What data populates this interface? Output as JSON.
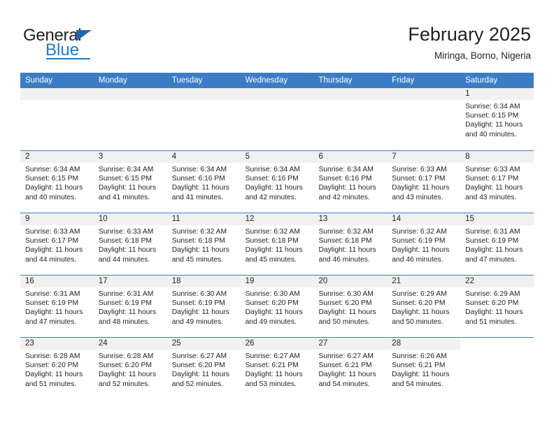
{
  "brand": {
    "name_part1": "General",
    "name_part2": "Blue",
    "triangle_color": "#1f68b0",
    "blue_color": "#1f7cc4"
  },
  "header": {
    "title": "February 2025",
    "subtitle": "Miringa, Borno, Nigeria",
    "header_bg": "#3b7dc4",
    "daynum_bg": "#f1f1f1"
  },
  "weekdays": [
    "Sunday",
    "Monday",
    "Tuesday",
    "Wednesday",
    "Thursday",
    "Friday",
    "Saturday"
  ],
  "labels": {
    "sunrise_prefix": "Sunrise:",
    "sunset_prefix": "Sunset:",
    "daylight_prefix": "Daylight:"
  },
  "weeks": [
    [
      {
        "empty": true
      },
      {
        "empty": true
      },
      {
        "empty": true
      },
      {
        "empty": true
      },
      {
        "empty": true
      },
      {
        "empty": true
      },
      {
        "day": "1",
        "sunrise": "Sunrise: 6:34 AM",
        "sunset": "Sunset: 6:15 PM",
        "daylight_line1": "Daylight: 11 hours",
        "daylight_line2": "and 40 minutes."
      }
    ],
    [
      {
        "day": "2",
        "sunrise": "Sunrise: 6:34 AM",
        "sunset": "Sunset: 6:15 PM",
        "daylight_line1": "Daylight: 11 hours",
        "daylight_line2": "and 40 minutes."
      },
      {
        "day": "3",
        "sunrise": "Sunrise: 6:34 AM",
        "sunset": "Sunset: 6:15 PM",
        "daylight_line1": "Daylight: 11 hours",
        "daylight_line2": "and 41 minutes."
      },
      {
        "day": "4",
        "sunrise": "Sunrise: 6:34 AM",
        "sunset": "Sunset: 6:16 PM",
        "daylight_line1": "Daylight: 11 hours",
        "daylight_line2": "and 41 minutes."
      },
      {
        "day": "5",
        "sunrise": "Sunrise: 6:34 AM",
        "sunset": "Sunset: 6:16 PM",
        "daylight_line1": "Daylight: 11 hours",
        "daylight_line2": "and 42 minutes."
      },
      {
        "day": "6",
        "sunrise": "Sunrise: 6:34 AM",
        "sunset": "Sunset: 6:16 PM",
        "daylight_line1": "Daylight: 11 hours",
        "daylight_line2": "and 42 minutes."
      },
      {
        "day": "7",
        "sunrise": "Sunrise: 6:33 AM",
        "sunset": "Sunset: 6:17 PM",
        "daylight_line1": "Daylight: 11 hours",
        "daylight_line2": "and 43 minutes."
      },
      {
        "day": "8",
        "sunrise": "Sunrise: 6:33 AM",
        "sunset": "Sunset: 6:17 PM",
        "daylight_line1": "Daylight: 11 hours",
        "daylight_line2": "and 43 minutes."
      }
    ],
    [
      {
        "day": "9",
        "sunrise": "Sunrise: 6:33 AM",
        "sunset": "Sunset: 6:17 PM",
        "daylight_line1": "Daylight: 11 hours",
        "daylight_line2": "and 44 minutes."
      },
      {
        "day": "10",
        "sunrise": "Sunrise: 6:33 AM",
        "sunset": "Sunset: 6:18 PM",
        "daylight_line1": "Daylight: 11 hours",
        "daylight_line2": "and 44 minutes."
      },
      {
        "day": "11",
        "sunrise": "Sunrise: 6:32 AM",
        "sunset": "Sunset: 6:18 PM",
        "daylight_line1": "Daylight: 11 hours",
        "daylight_line2": "and 45 minutes."
      },
      {
        "day": "12",
        "sunrise": "Sunrise: 6:32 AM",
        "sunset": "Sunset: 6:18 PM",
        "daylight_line1": "Daylight: 11 hours",
        "daylight_line2": "and 45 minutes."
      },
      {
        "day": "13",
        "sunrise": "Sunrise: 6:32 AM",
        "sunset": "Sunset: 6:18 PM",
        "daylight_line1": "Daylight: 11 hours",
        "daylight_line2": "and 46 minutes."
      },
      {
        "day": "14",
        "sunrise": "Sunrise: 6:32 AM",
        "sunset": "Sunset: 6:19 PM",
        "daylight_line1": "Daylight: 11 hours",
        "daylight_line2": "and 46 minutes."
      },
      {
        "day": "15",
        "sunrise": "Sunrise: 6:31 AM",
        "sunset": "Sunset: 6:19 PM",
        "daylight_line1": "Daylight: 11 hours",
        "daylight_line2": "and 47 minutes."
      }
    ],
    [
      {
        "day": "16",
        "sunrise": "Sunrise: 6:31 AM",
        "sunset": "Sunset: 6:19 PM",
        "daylight_line1": "Daylight: 11 hours",
        "daylight_line2": "and 47 minutes."
      },
      {
        "day": "17",
        "sunrise": "Sunrise: 6:31 AM",
        "sunset": "Sunset: 6:19 PM",
        "daylight_line1": "Daylight: 11 hours",
        "daylight_line2": "and 48 minutes."
      },
      {
        "day": "18",
        "sunrise": "Sunrise: 6:30 AM",
        "sunset": "Sunset: 6:19 PM",
        "daylight_line1": "Daylight: 11 hours",
        "daylight_line2": "and 49 minutes."
      },
      {
        "day": "19",
        "sunrise": "Sunrise: 6:30 AM",
        "sunset": "Sunset: 6:20 PM",
        "daylight_line1": "Daylight: 11 hours",
        "daylight_line2": "and 49 minutes."
      },
      {
        "day": "20",
        "sunrise": "Sunrise: 6:30 AM",
        "sunset": "Sunset: 6:20 PM",
        "daylight_line1": "Daylight: 11 hours",
        "daylight_line2": "and 50 minutes."
      },
      {
        "day": "21",
        "sunrise": "Sunrise: 6:29 AM",
        "sunset": "Sunset: 6:20 PM",
        "daylight_line1": "Daylight: 11 hours",
        "daylight_line2": "and 50 minutes."
      },
      {
        "day": "22",
        "sunrise": "Sunrise: 6:29 AM",
        "sunset": "Sunset: 6:20 PM",
        "daylight_line1": "Daylight: 11 hours",
        "daylight_line2": "and 51 minutes."
      }
    ],
    [
      {
        "day": "23",
        "sunrise": "Sunrise: 6:28 AM",
        "sunset": "Sunset: 6:20 PM",
        "daylight_line1": "Daylight: 11 hours",
        "daylight_line2": "and 51 minutes."
      },
      {
        "day": "24",
        "sunrise": "Sunrise: 6:28 AM",
        "sunset": "Sunset: 6:20 PM",
        "daylight_line1": "Daylight: 11 hours",
        "daylight_line2": "and 52 minutes."
      },
      {
        "day": "25",
        "sunrise": "Sunrise: 6:27 AM",
        "sunset": "Sunset: 6:20 PM",
        "daylight_line1": "Daylight: 11 hours",
        "daylight_line2": "and 52 minutes."
      },
      {
        "day": "26",
        "sunrise": "Sunrise: 6:27 AM",
        "sunset": "Sunset: 6:21 PM",
        "daylight_line1": "Daylight: 11 hours",
        "daylight_line2": "and 53 minutes."
      },
      {
        "day": "27",
        "sunrise": "Sunrise: 6:27 AM",
        "sunset": "Sunset: 6:21 PM",
        "daylight_line1": "Daylight: 11 hours",
        "daylight_line2": "and 54 minutes."
      },
      {
        "day": "28",
        "sunrise": "Sunrise: 6:26 AM",
        "sunset": "Sunset: 6:21 PM",
        "daylight_line1": "Daylight: 11 hours",
        "daylight_line2": "and 54 minutes."
      },
      {
        "blank": true
      }
    ]
  ]
}
